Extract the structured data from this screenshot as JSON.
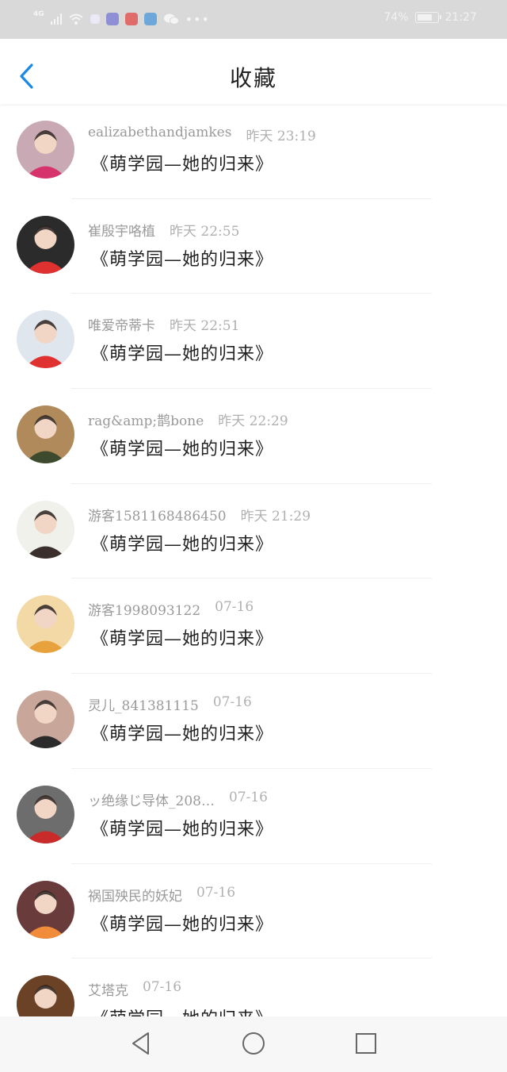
{
  "status_bar": {
    "network": "4G",
    "battery_percent": "74%",
    "time": "21:27",
    "battery_level": 0.74,
    "icons": [
      "signal-icon",
      "wifi-icon",
      "notification-icon",
      "music-app-icon",
      "book-app-icon",
      "browser-app-icon",
      "wechat-icon",
      "more-dots-icon"
    ]
  },
  "header": {
    "title": "收藏",
    "back_icon": "chevron-left-icon"
  },
  "accent_color": "#1e88e5",
  "favorites": [
    {
      "user": "ealizabethandjamkes",
      "time": "昨天 23:19",
      "book": "《萌学园—她的归来》",
      "avatar_color": "#c9a9b3",
      "avatar_accent": "#d6336c"
    },
    {
      "user": "崔殷宇咯植",
      "time": "昨天 22:55",
      "book": "《萌学园—她的归来》",
      "avatar_color": "#2b2b2b",
      "avatar_accent": "#e03131"
    },
    {
      "user": "唯爱帝蒂卡",
      "time": "昨天 22:51",
      "book": "《萌学园—她的归来》",
      "avatar_color": "#dfe6ee",
      "avatar_accent": "#e03131"
    },
    {
      "user": "rag&amp;鹊bone",
      "time": "昨天 22:29",
      "book": "《萌学园—她的归来》",
      "avatar_color": "#b08a5a",
      "avatar_accent": "#3d4a2e"
    },
    {
      "user": "游客1581168486450",
      "time": "昨天 21:29",
      "book": "《萌学园—她的归来》",
      "avatar_color": "#f1f1ec",
      "avatar_accent": "#3a2f2a"
    },
    {
      "user": "游客1998093122",
      "time": "07-16",
      "book": "《萌学园—她的归来》",
      "avatar_color": "#f3d9a6",
      "avatar_accent": "#e8a23d"
    },
    {
      "user": "灵儿_841381115",
      "time": "07-16",
      "book": "《萌学园—她的归来》",
      "avatar_color": "#c8a79a",
      "avatar_accent": "#2b2b2b"
    },
    {
      "user": "ッ绝缘じ导体_208…",
      "time": "07-16",
      "book": "《萌学园—她的归来》",
      "avatar_color": "#6d6d6d",
      "avatar_accent": "#c92a2a"
    },
    {
      "user": "祸国殃民的妖妃",
      "time": "07-16",
      "book": "《萌学园—她的归来》",
      "avatar_color": "#6a3b3b",
      "avatar_accent": "#f08c3a"
    },
    {
      "user": "艾塔克",
      "time": "07-16",
      "book": "《萌学园—她的归来》",
      "avatar_color": "#6b4226",
      "avatar_accent": "#f1c9a5"
    }
  ],
  "nav": {
    "icons": [
      "back-triangle-icon",
      "home-circle-icon",
      "recents-square-icon"
    ]
  }
}
